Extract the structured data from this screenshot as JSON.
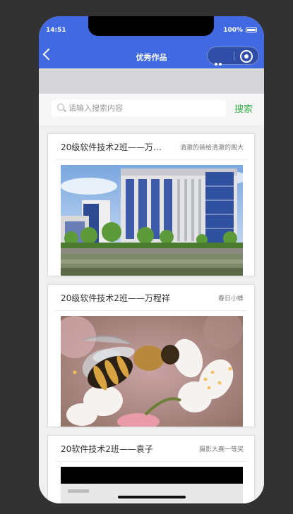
{
  "status": {
    "time": "14:51",
    "battery": "100%"
  },
  "nav": {
    "title": "优秀作品"
  },
  "search": {
    "placeholder": "请输入搜索内容",
    "button_label": "搜索"
  },
  "colors": {
    "accent": "#4169e1",
    "search_button": "#39b54a"
  },
  "works": [
    {
      "title": "20级软件技术2班——万…",
      "subtitle": "清澈的装给清澈的阁大",
      "image": "campus-building-photo"
    },
    {
      "title": "20级软件技术2班——万程祥",
      "subtitle": "春日小蜂",
      "image": "bee-on-blossom-photo"
    },
    {
      "title": "20软件技术2班——袁子",
      "subtitle": "摄影大赛一等奖",
      "image": "dark-photo"
    }
  ]
}
